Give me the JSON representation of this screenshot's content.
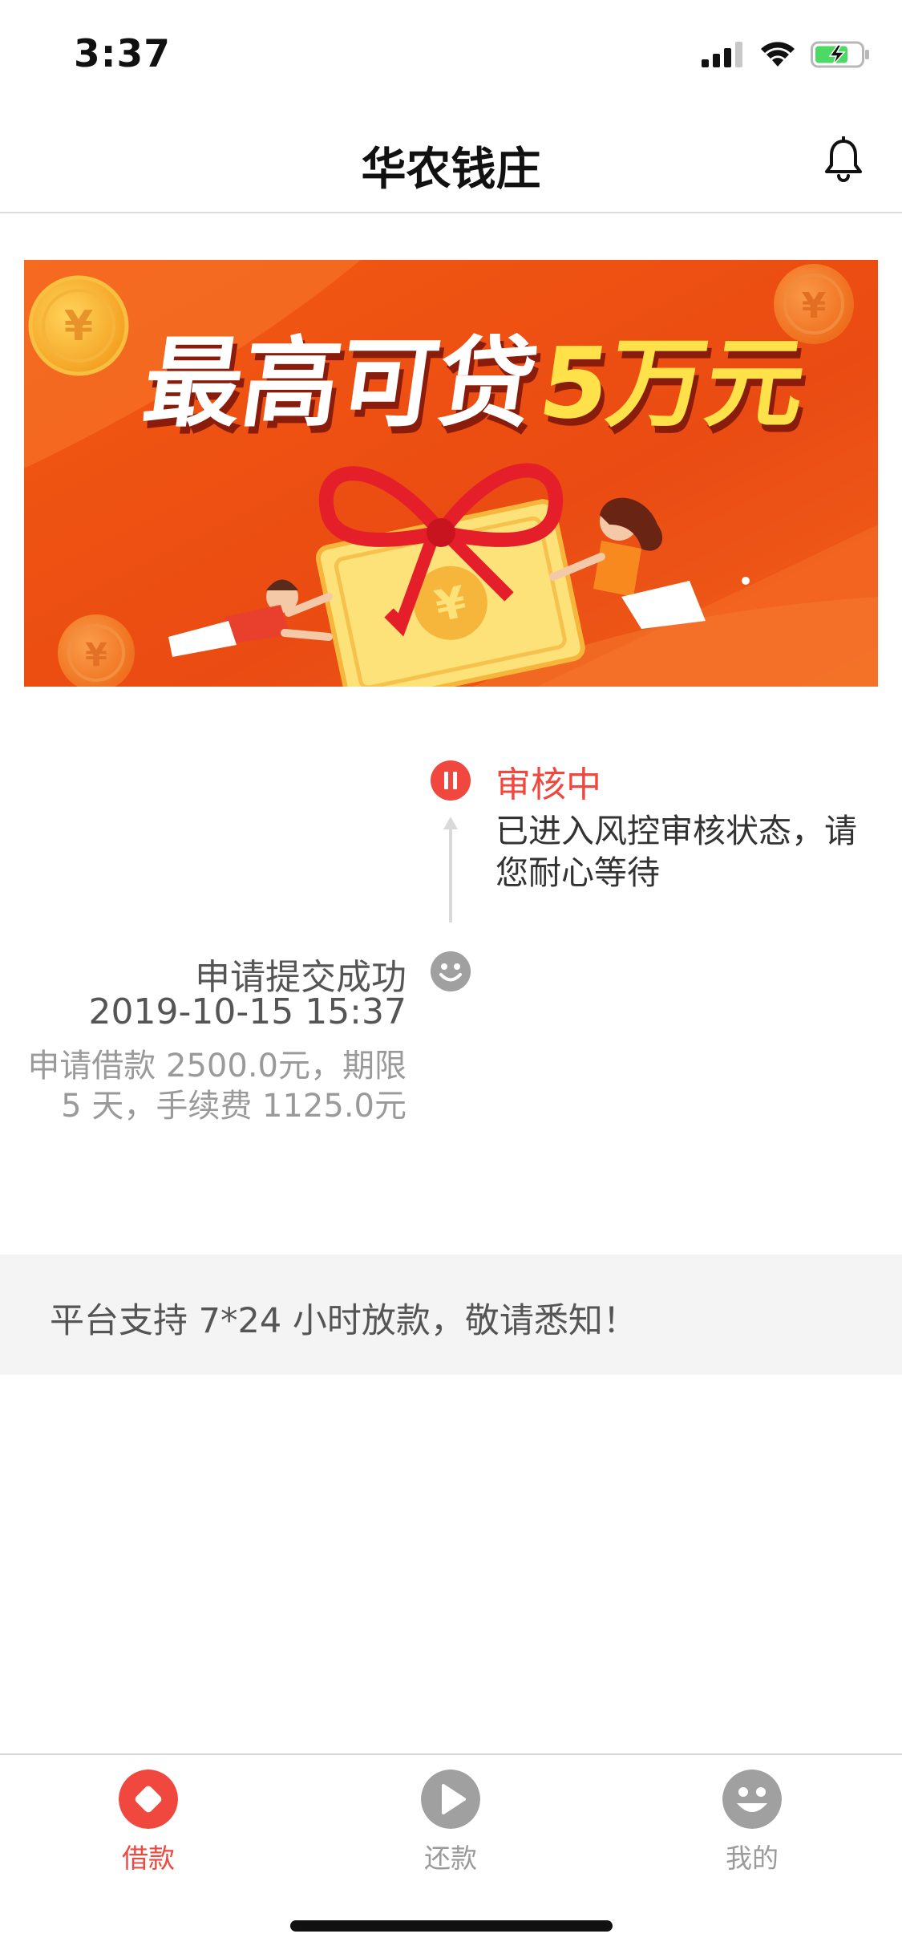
{
  "status_bar": {
    "time": "3:37",
    "icons": [
      "signal-icon",
      "wifi-icon",
      "battery-charging-icon"
    ]
  },
  "nav": {
    "title": "华农钱庄",
    "right_icon": "bell-icon"
  },
  "banner": {
    "headline_main": "最高可贷",
    "headline_accent": "5万元",
    "currency_symbol": "¥",
    "colors": {
      "background": "#f2561d",
      "accent": "#ffe14a"
    }
  },
  "timeline": {
    "current": {
      "title": "审核中",
      "description": "已进入风控审核状态，请您耐心等待"
    },
    "submitted": {
      "title": "申请提交成功",
      "time": "2019-10-15 15:37",
      "description": "申请借款 2500.0元，期限 5 天，手续费 1125.0元"
    }
  },
  "notice": {
    "text": "平台支持 7*24 小时放款，敬请悉知！"
  },
  "tabs": [
    {
      "label": "借款",
      "icon": "diamond-icon",
      "active": true
    },
    {
      "label": "还款",
      "icon": "play-icon",
      "active": false
    },
    {
      "label": "我的",
      "icon": "smiley-icon",
      "active": false
    }
  ],
  "colors": {
    "accent": "#f0473f",
    "inactive": "#a0a0a0",
    "notice_bg": "#f4f4f4"
  }
}
